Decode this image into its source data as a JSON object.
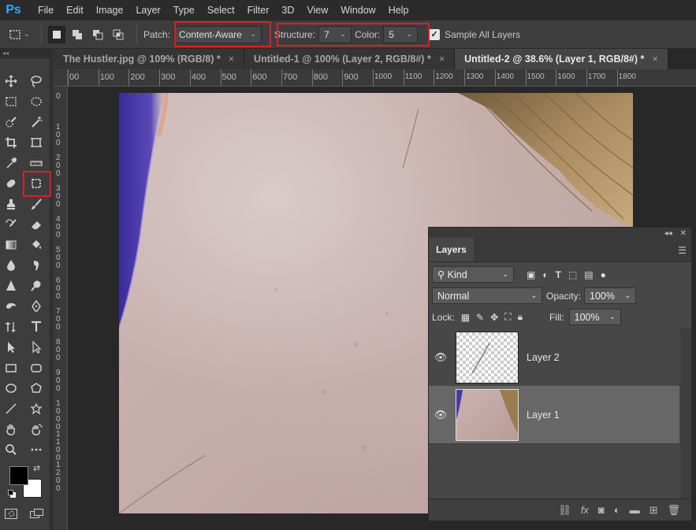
{
  "app": {
    "logo": "Ps"
  },
  "menu": [
    "File",
    "Edit",
    "Image",
    "Layer",
    "Type",
    "Select",
    "Filter",
    "3D",
    "View",
    "Window",
    "Help"
  ],
  "options": {
    "patch_label": "Patch:",
    "patch_value": "Content-Aware",
    "structure_label": "Structure:",
    "structure_value": "7",
    "color_label": "Color:",
    "color_value": "5",
    "sample_all_layers": "Sample All Layers",
    "sample_checked": true
  },
  "tabs": [
    {
      "label": "The Hustler.jpg @ 109% (RGB/8) *",
      "close": "×",
      "active": false
    },
    {
      "label": "Untitled-1 @ 100% (Layer 2, RGB/8#) *",
      "close": "×",
      "active": false
    },
    {
      "label": "Untitled-2 @ 38.6% (Layer 1, RGB/8#) *",
      "close": "×",
      "active": true
    }
  ],
  "ruler": {
    "h_ticks": [
      "00",
      "100",
      "200",
      "300",
      "400",
      "500",
      "600",
      "700",
      "800",
      "900",
      "1000",
      "1100",
      "1200",
      "1300",
      "1400",
      "1500",
      "1600",
      "1700",
      "1800"
    ],
    "v_ticks": [
      "0",
      "1\n0\n0",
      "2\n0\n0",
      "3\n0\n0",
      "4\n0\n0",
      "5\n0\n0",
      "6\n0\n0",
      "7\n0\n0",
      "8\n0\n0",
      "9\n0\n0",
      "1\n0\n0\n0",
      "1\n1\n0\n0",
      "1\n2\n0\n0"
    ]
  },
  "layers_panel": {
    "title": "Layers",
    "filter_kind": "Kind",
    "blend_mode": "Normal",
    "opacity_label": "Opacity:",
    "opacity_value": "100%",
    "lock_label": "Lock:",
    "fill_label": "Fill:",
    "fill_value": "100%",
    "layers": [
      {
        "name": "Layer 2",
        "visible": true,
        "selected": false
      },
      {
        "name": "Layer 1",
        "visible": true,
        "selected": true
      }
    ]
  },
  "colors": {
    "highlight_red": "#d9202a",
    "foreground": "#000000",
    "background": "#ffffff"
  }
}
